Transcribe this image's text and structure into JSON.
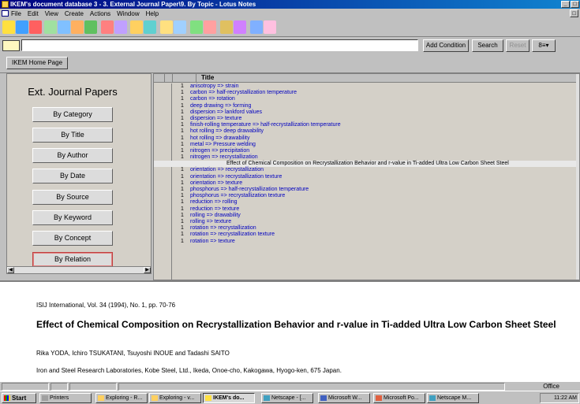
{
  "window": {
    "title": "IKEM's document database 3 - 3. External Journal Paper\\9. By Topic - Lotus Notes"
  },
  "menu": [
    "File",
    "Edit",
    "View",
    "Create",
    "Actions",
    "Window",
    "Help"
  ],
  "search": {
    "value": "",
    "add_condition": "Add Condition",
    "search": "Search",
    "reset": "Reset",
    "options": "8≡▾"
  },
  "linkbar": {
    "home": "IKEM Home Page"
  },
  "nav": {
    "title": "Ext. Journal Papers",
    "buttons": [
      "By Category",
      "By Title",
      "By Author",
      "By Date",
      "By Source",
      "By Keyword",
      "By Concept",
      "By Relation"
    ],
    "selected": "By Relation"
  },
  "view": {
    "column_title": "Title",
    "rows": [
      {
        "count": "1",
        "title": "anisotropy => strain"
      },
      {
        "count": "1",
        "title": "carbon => half-recrystallization temperature"
      },
      {
        "count": "1",
        "title": "carbon => rotation"
      },
      {
        "count": "1",
        "title": "deep drawing => forming"
      },
      {
        "count": "1",
        "title": "dispersion => lankford values"
      },
      {
        "count": "1",
        "title": "dispersion => texture"
      },
      {
        "count": "1",
        "title": "finish-rolling temperature => half-recrystallization temperature"
      },
      {
        "count": "1",
        "title": "hot rolling => deep drawability"
      },
      {
        "count": "1",
        "title": "hot rolling => drawability"
      },
      {
        "count": "1",
        "title": "metal => Pressure welding"
      },
      {
        "count": "1",
        "title": "nitrogen => precipitation"
      },
      {
        "count": "1",
        "title": "nitrogen => recrystallization"
      },
      {
        "count": "",
        "title": "Effect of Chemical Composition on Recrystallization Behavior and r-value in Ti-added Ultra Low Carbon Sheet Steel",
        "highlight": true
      },
      {
        "count": "1",
        "title": "orientation => recrystallization"
      },
      {
        "count": "1",
        "title": "orientation => recrystallization texture"
      },
      {
        "count": "1",
        "title": "orientation => texture"
      },
      {
        "count": "1",
        "title": "phosphorus => half-recrystallization temperature"
      },
      {
        "count": "1",
        "title": "phosphorus => recrystallization texture"
      },
      {
        "count": "1",
        "title": "reduction => rolling"
      },
      {
        "count": "1",
        "title": "reduction => texture"
      },
      {
        "count": "1",
        "title": "rolling => drawability"
      },
      {
        "count": "1",
        "title": "rolling => texture"
      },
      {
        "count": "1",
        "title": "rotation => recrystallization"
      },
      {
        "count": "1",
        "title": "rotation => recrystallization texture"
      },
      {
        "count": "1",
        "title": "rotation => texture"
      }
    ]
  },
  "preview": {
    "citation": "ISIJ International, Vol. 34 (1994), No. 1, pp. 70-76",
    "title": "Effect of Chemical Composition on Recrystallization Behavior and r-value in Ti-added Ultra Low Carbon Sheet Steel",
    "authors": "Rika YODA, Ichiro TSUKATANI, Tsuyoshi INOUE and Tadashi SAITO",
    "affiliation": "Iron and Steel Research Laboratories, Kobe Steel, Ltd., Ikeda, Onoe-cho, Kakogawa, Hyogo-ken, 675 Japan."
  },
  "status": {
    "office": "Office"
  },
  "taskbar": {
    "start": "Start",
    "tasks": [
      "Printers",
      "Exploring - R...",
      "Exploring - v...",
      "IKEM's do...",
      "Netscape - [...",
      "Microsoft W...",
      "Microsoft Po...",
      "Netscape M..."
    ],
    "active": "IKEM's do...",
    "clock": "11:22 AM"
  },
  "colors": {
    "titlebar": "#000080",
    "link": "#0000c0",
    "selected_border": "#c04040"
  }
}
